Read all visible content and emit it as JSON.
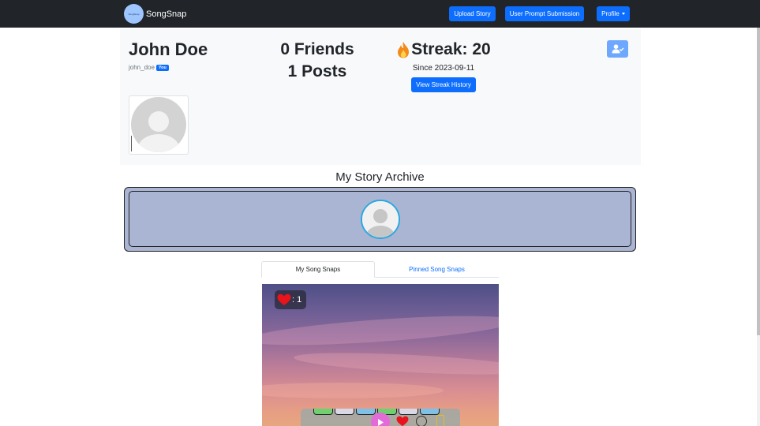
{
  "navbar": {
    "brand_logo_text": "SongSnap",
    "brand_name": "SongSnap",
    "upload_story": "Upload Story",
    "user_prompt_submission": "User Prompt Submission",
    "profile": "Profile"
  },
  "profile": {
    "name": "John Doe",
    "username": "john_doe",
    "you_badge": "You",
    "friends": "0 Friends",
    "posts": "1 Posts",
    "streak": "Streak: 20",
    "since": "Since 2023-09-11",
    "view_streak_history": "View Streak History"
  },
  "archive": {
    "title": "My Story Archive"
  },
  "tabs": [
    {
      "label": "My Song Snaps",
      "active": true
    },
    {
      "label": "Pinned Song Snaps",
      "active": false
    }
  ],
  "post": {
    "likes": ": 1"
  },
  "colors": {
    "navbar": "#212529",
    "primary": "#0d6efd",
    "card": "#f8f9fa",
    "archive": "#aab4d3",
    "story_ring": "#2aa8e0"
  },
  "icons": [
    "fire-icon",
    "add-friend-icon",
    "avatar-placeholder-icon",
    "heart-icon",
    "play-icon",
    "comment-icon",
    "bookmark-icon"
  ]
}
